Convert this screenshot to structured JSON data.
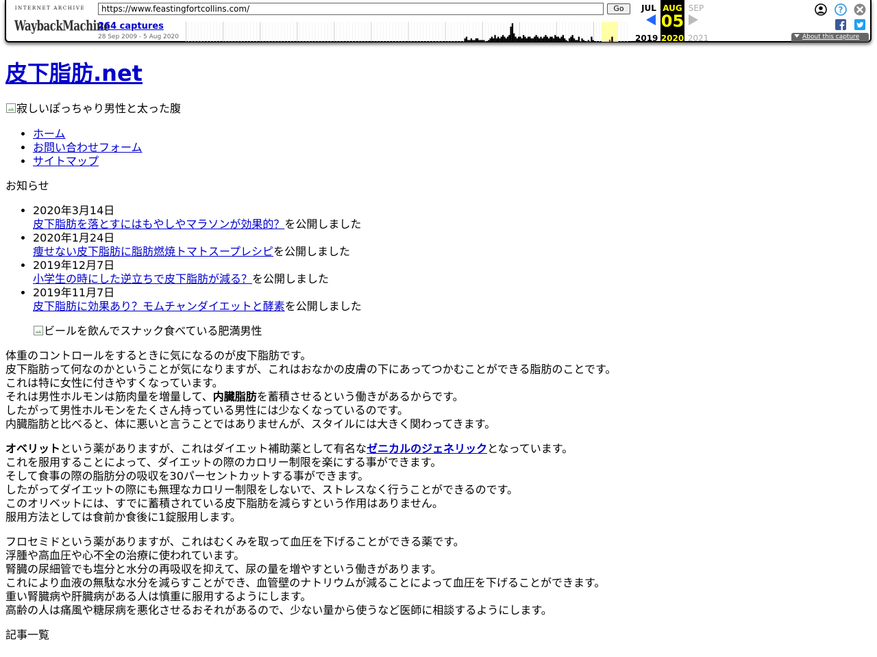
{
  "wayback": {
    "logo_top": "INTERNET ARCHIVE",
    "logo_main": "Wayback",
    "logo_main2": "Machine",
    "url": "https://www.feastingfortcollins.com/",
    "go_label": "Go",
    "captures": "264 captures",
    "range": "28 Sep 2009 - 5 Aug 2020",
    "prev_month": "JUL",
    "cur_month": "AUG",
    "cur_day": "05",
    "next_month": "SEP",
    "prev_year": "2019",
    "cur_year": "2020",
    "next_year": "2021",
    "about": "About this capture",
    "sparkline": [
      0,
      0,
      0,
      0,
      0,
      0,
      0,
      0,
      0,
      0,
      0,
      0,
      0,
      0,
      0,
      0,
      0,
      0,
      0,
      0,
      0,
      0,
      0,
      0,
      0,
      0,
      0,
      0,
      0,
      0,
      0,
      0,
      0,
      0,
      0,
      0,
      0,
      0,
      0,
      0,
      0,
      0,
      0,
      0,
      0,
      0,
      0,
      0,
      0,
      0,
      0,
      0,
      0,
      0,
      0,
      0,
      0,
      0,
      0,
      0,
      0,
      0,
      0,
      0,
      0,
      0,
      0,
      0,
      0,
      0,
      0,
      0,
      0,
      0,
      0,
      0,
      0,
      0,
      0,
      0,
      0,
      0,
      0,
      0,
      0,
      0,
      0,
      0,
      0,
      0,
      0,
      0,
      0,
      0,
      0,
      0,
      0,
      0,
      0,
      0,
      0,
      0,
      0,
      0,
      0,
      0,
      0,
      0,
      0,
      0,
      0,
      0,
      0,
      0,
      0,
      0,
      0,
      0,
      0,
      0,
      0,
      0,
      0,
      0,
      0,
      0,
      0,
      0,
      0,
      0,
      0,
      0,
      0,
      0,
      0,
      0,
      0,
      0,
      0,
      0,
      0,
      0,
      0,
      0,
      0,
      0,
      0,
      0,
      0,
      0,
      0,
      0,
      0,
      0,
      0,
      0,
      0,
      0,
      0,
      0,
      0,
      0,
      0,
      0,
      0,
      0,
      0,
      0,
      0,
      0,
      0,
      0,
      0,
      0,
      0,
      0,
      2,
      3,
      1,
      1,
      2,
      1,
      1,
      2,
      2,
      1,
      1,
      1,
      1,
      0,
      0,
      1,
      2,
      3,
      2,
      4,
      2,
      3,
      2,
      3,
      4,
      3,
      2,
      3,
      4,
      9,
      11,
      5,
      3,
      2,
      3,
      3,
      2,
      4,
      3,
      2,
      3,
      3,
      2,
      2,
      3,
      4,
      3,
      2,
      3,
      2,
      3,
      4,
      3,
      2,
      3,
      3,
      2,
      4,
      3,
      3,
      2,
      3,
      4,
      2,
      1,
      0,
      2,
      3,
      4,
      2,
      1,
      1,
      3,
      0,
      2,
      1,
      0,
      0,
      1,
      0,
      3,
      1,
      0,
      0,
      0,
      0,
      0,
      0,
      0,
      0,
      0,
      0,
      0,
      3,
      0,
      0,
      0,
      0,
      0,
      0,
      0,
      0,
      0,
      0,
      0
    ]
  },
  "site": {
    "title": "皮下脂肪.net",
    "hero_alt": "寂しいぽっちゃり男性と太った腹",
    "nav": [
      "ホーム",
      "お問い合わせフォーム",
      "サイトマップ"
    ],
    "news_heading": "お知らせ",
    "news": [
      {
        "date": "2020年3月14日",
        "link": "皮下脂肪を落とすにはもやしやマラソンが効果的？",
        "suffix": "を公開しました"
      },
      {
        "date": "2020年1月24日",
        "link": "痩せない皮下脂肪に脂肪燃焼トマトスープレシピ",
        "suffix": "を公開しました"
      },
      {
        "date": "2019年12月7日",
        "link": "小学生の時にした逆立ちで皮下脂肪が減る？",
        "suffix": "を公開しました"
      },
      {
        "date": "2019年11月7日",
        "link": "皮下脂肪に効果あり？モムチャンダイエットと酵素",
        "suffix": "を公開しました"
      }
    ],
    "news_img_alt": "ビールを飲んでスナック食べている肥満男性",
    "p1": {
      "l1": "体重のコントロールをするときに気になるのが皮下脂肪です。",
      "l2": "皮下脂肪って何なのかということが気になりますが、これはおなかの皮膚の下にあってつかむことができる脂肪のことです。",
      "l3": "これは特に女性に付きやすくなっています。",
      "l4a": "それは男性ホルモンは筋肉量を増量して、",
      "l4b": "内臓脂肪",
      "l4c": "を蓄積させるという働きがあるからです。",
      "l5": "したがって男性ホルモンをたくさん持っている男性には少なくなっているのです。",
      "l6": "内臓脂肪と比べると、体に悪いと言うことではありませんが、スタイルには大きく関わってきます。"
    },
    "p2": {
      "l1a": "オベリット",
      "l1b": "という薬がありますが、これはダイエット補助薬として有名な",
      "l1c": "ゼニカルのジェネリック",
      "l1d": "となっています。",
      "l2": "これを服用することによって、ダイエットの際のカロリー制限を楽にする事ができます。",
      "l3": "そして食事の際の脂肪分の吸収を30パーセントカットする事ができます。",
      "l4": "したがってダイエットの際にも無理なカロリー制限をしないで、ストレスなく行うことができるのです。",
      "l5": "このオリベットには、すでに蓄積されている皮下脂肪を減らすという作用はありません。",
      "l6": "服用方法としては食前か食後に1錠服用します。"
    },
    "p3": {
      "l1": "フロセミドという薬がありますが、これはむくみを取って血圧を下げることができる薬です。",
      "l2": "浮腫や高血圧や心不全の治療に使われています。",
      "l3": "腎臓の尿細管でも塩分と水分の再吸収を抑えて、尿の量を増やすという働きがあります。",
      "l4": "これにより血液の無駄な水分を減らすことができ、血管壁のナトリウムが減ることによって血圧を下げることができます。",
      "l5": "重い腎臓病や肝臓病がある人は慎重に服用するようにします。",
      "l6": "高齢の人は痛風や糖尿病を悪化させるおそれがあるので、少ない量から使うなど医師に相談するようにします。"
    },
    "articles_heading": "記事一覧"
  }
}
